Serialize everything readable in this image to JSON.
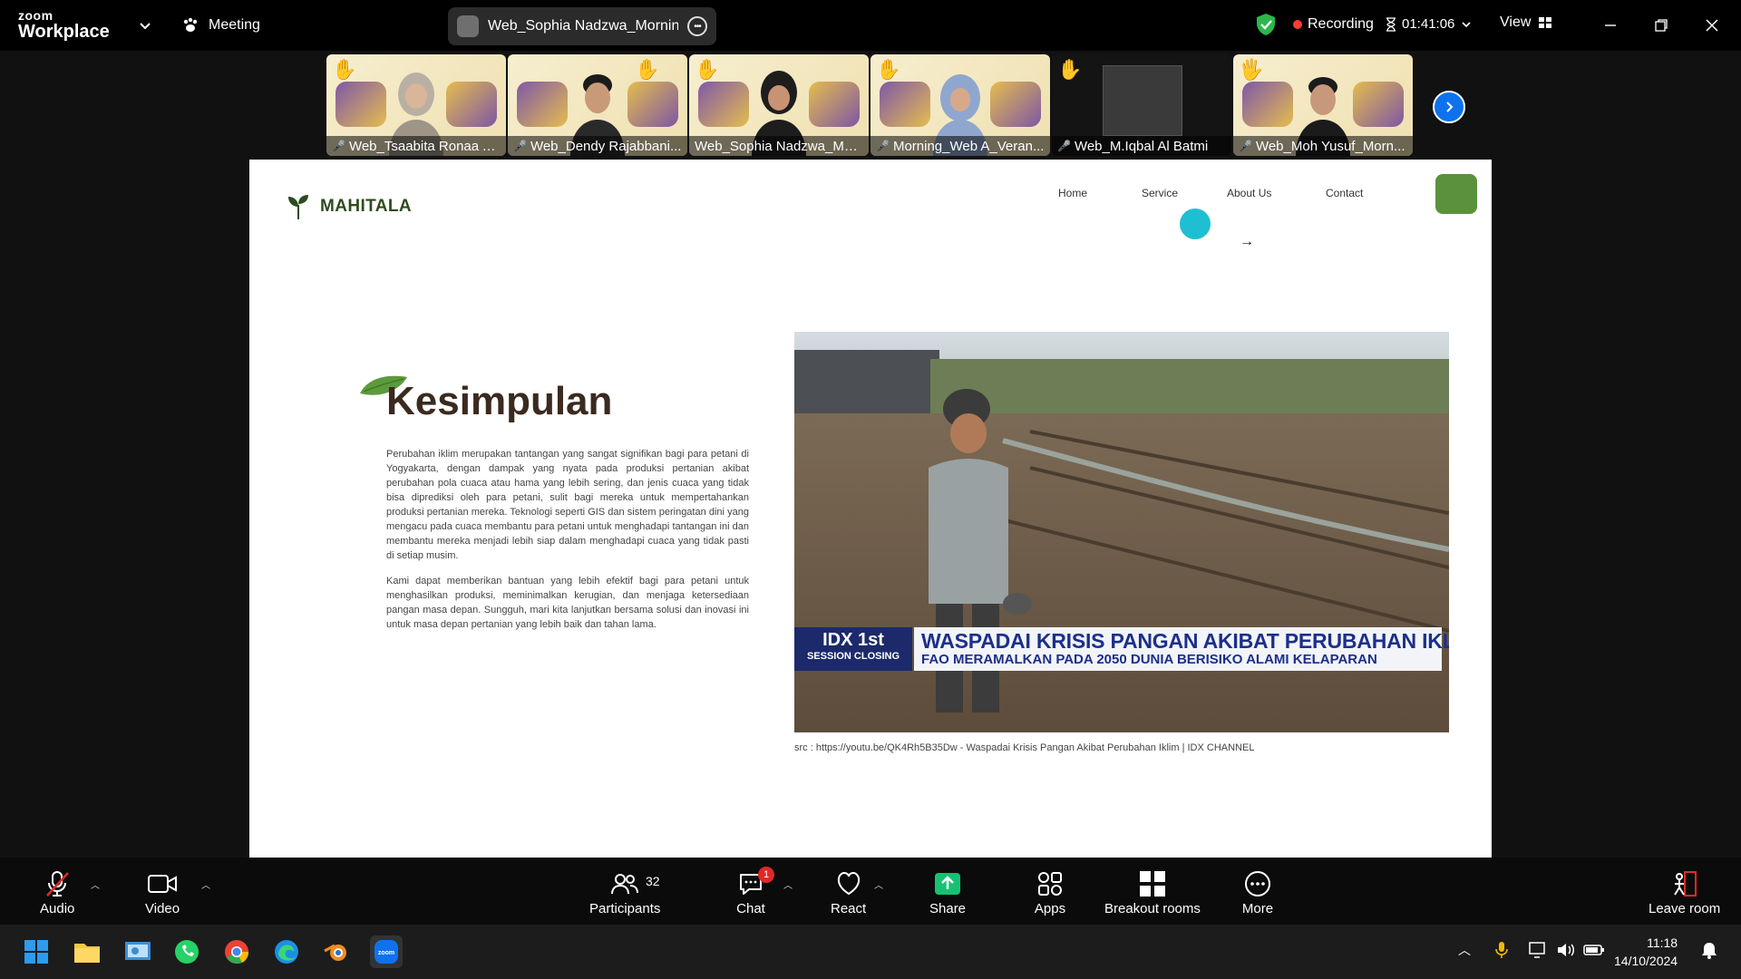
{
  "app": {
    "brand_small": "zoom",
    "brand_large": "Workplace"
  },
  "header": {
    "meeting_label": "Meeting",
    "share_label": "Web_Sophia Nadzwa_Morning's",
    "recording_label": "Recording",
    "timer": "01:41:06",
    "view_label": "View"
  },
  "participants": [
    {
      "name": "Web_Tsaabita Ronaa A..."
    },
    {
      "name": "Web_Dendy Rajabbani..."
    },
    {
      "name": "Web_Sophia Nadzwa_Mor..."
    },
    {
      "name": "Morning_Web A_Veran..."
    },
    {
      "name": "Web_M.Iqbal Al Batmi"
    },
    {
      "name": "Web_Moh Yusuf_Morn..."
    }
  ],
  "site": {
    "brand": "MAHITALA",
    "nav": [
      "Home",
      "Service",
      "About Us",
      "Contact"
    ],
    "heading": "Kesimpulan",
    "para1": "Perubahan iklim merupakan tantangan yang sangat signifikan bagi para petani di Yogyakarta, dengan dampak yang nyata pada produksi pertanian akibat perubahan pola cuaca atau hama yang lebih sering, dan jenis cuaca yang tidak bisa diprediksi oleh para petani, sulit bagi mereka untuk mempertahankan produksi pertanian mereka. Teknologi seperti GIS dan sistem peringatan dini yang mengacu pada cuaca membantu para petani untuk menghadapi tantangan ini dan membantu mereka menjadi lebih siap dalam menghadapi cuaca yang tidak pasti di setiap musim.",
    "para2": "Kami dapat memberikan bantuan yang lebih efektif bagi para petani untuk menghasilkan produksi, meminimalkan kerugian, dan menjaga ketersediaan pangan masa depan. Sungguh, mari kita lanjutkan bersama solusi dan inovasi ini untuk masa depan pertanian yang lebih baik dan tahan lama.",
    "video_badge_1": "IDX 1st",
    "video_badge_2": "SESSION CLOSING",
    "video_headline": "WASPADAI KRISIS PANGAN AKIBAT PERUBAHAN IKLIM",
    "video_subline": "FAO MERAMALKAN PADA 2050 DUNIA BERISIKO ALAMI KELAPARAN",
    "source": "src : https://youtu.be/QK4Rh5B35Dw - Waspadai Krisis Pangan Akibat Perubahan Iklim | IDX CHANNEL"
  },
  "toolbar": {
    "audio": "Audio",
    "video": "Video",
    "participants": "Participants",
    "participant_count": "32",
    "chat": "Chat",
    "chat_badge": "1",
    "react": "React",
    "share": "Share",
    "apps": "Apps",
    "breakout": "Breakout rooms",
    "more": "More",
    "leave": "Leave room"
  },
  "taskbar": {
    "time": "11:18",
    "date": "14/10/2024"
  },
  "colors": {
    "accent_green": "#5b913d",
    "zoom_blue": "#0e72ed",
    "rec_red": "#ff3b30",
    "share_green": "#16c172"
  }
}
